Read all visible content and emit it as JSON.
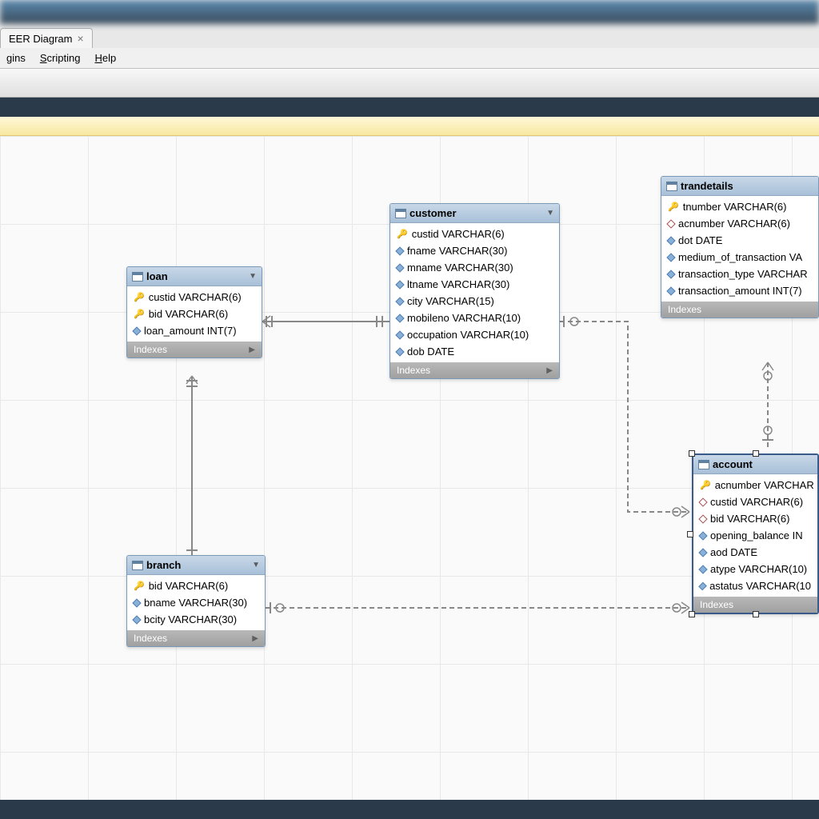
{
  "tab": {
    "label": "EER Diagram"
  },
  "menu": {
    "items": [
      "gins",
      "Scripting",
      "Help"
    ]
  },
  "entities": {
    "loan": {
      "title": "loan",
      "columns": [
        {
          "kind": "pk",
          "text": "custid VARCHAR(6)"
        },
        {
          "kind": "pk",
          "text": "bid VARCHAR(6)"
        },
        {
          "kind": "attr",
          "text": "loan_amount INT(7)"
        }
      ],
      "footer": "Indexes"
    },
    "customer": {
      "title": "customer",
      "columns": [
        {
          "kind": "pk",
          "text": "custid VARCHAR(6)"
        },
        {
          "kind": "attr",
          "text": "fname VARCHAR(30)"
        },
        {
          "kind": "attr",
          "text": "mname VARCHAR(30)"
        },
        {
          "kind": "attr",
          "text": "ltname VARCHAR(30)"
        },
        {
          "kind": "attr",
          "text": "city VARCHAR(15)"
        },
        {
          "kind": "attr",
          "text": "mobileno VARCHAR(10)"
        },
        {
          "kind": "attr",
          "text": "occupation VARCHAR(10)"
        },
        {
          "kind": "attr",
          "text": "dob DATE"
        }
      ],
      "footer": "Indexes"
    },
    "trandetails": {
      "title": "trandetails",
      "columns": [
        {
          "kind": "pk",
          "text": "tnumber VARCHAR(6)"
        },
        {
          "kind": "fk",
          "text": "acnumber VARCHAR(6)"
        },
        {
          "kind": "attr",
          "text": "dot DATE"
        },
        {
          "kind": "attr",
          "text": "medium_of_transaction VA"
        },
        {
          "kind": "attr",
          "text": "transaction_type VARCHAR"
        },
        {
          "kind": "attr",
          "text": "transaction_amount INT(7)"
        }
      ],
      "footer": "Indexes"
    },
    "branch": {
      "title": "branch",
      "columns": [
        {
          "kind": "pk",
          "text": "bid VARCHAR(6)"
        },
        {
          "kind": "attr",
          "text": "bname VARCHAR(30)"
        },
        {
          "kind": "attr",
          "text": "bcity VARCHAR(30)"
        }
      ],
      "footer": "Indexes"
    },
    "account": {
      "title": "account",
      "columns": [
        {
          "kind": "pk",
          "text": "acnumber VARCHAR"
        },
        {
          "kind": "fk",
          "text": "custid VARCHAR(6)"
        },
        {
          "kind": "fk",
          "text": "bid VARCHAR(6)"
        },
        {
          "kind": "attr",
          "text": "opening_balance IN"
        },
        {
          "kind": "attr",
          "text": "aod DATE"
        },
        {
          "kind": "attr",
          "text": "atype VARCHAR(10)"
        },
        {
          "kind": "attr",
          "text": "astatus VARCHAR(10"
        }
      ],
      "footer": "Indexes"
    }
  }
}
